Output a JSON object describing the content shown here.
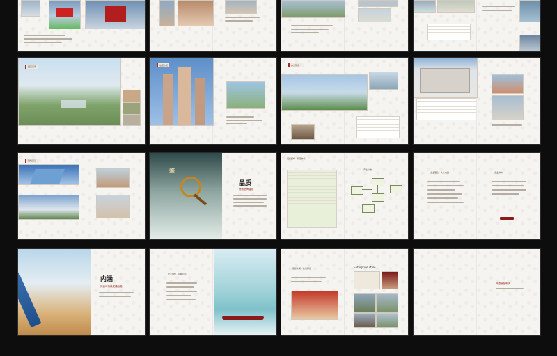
{
  "spreads": [
    {
      "id": "s1",
      "left_tags": [],
      "caption": ""
    },
    {
      "id": "s2"
    },
    {
      "id": "s3"
    },
    {
      "id": "s4"
    },
    {
      "id": "s5",
      "header": "园区风景"
    },
    {
      "id": "s6",
      "header": "住宅小区"
    },
    {
      "id": "s7",
      "header": "办公环境"
    },
    {
      "id": "s8",
      "header": "办公楼"
    },
    {
      "id": "s9",
      "header": "建筑风采"
    },
    {
      "id": "s10",
      "title": "品质",
      "subtitle": "缔造品牌建设",
      "emblem_title": "鉴"
    },
    {
      "id": "s11",
      "left_title": "组织结构 · 管理体系",
      "right_title": "产业分布"
    },
    {
      "id": "s12",
      "left_title": "企业理念 · 文化内涵",
      "right_title": "企业精神"
    },
    {
      "id": "s13",
      "title": "内涵",
      "subtitle": "缔造可持续发展战略"
    },
    {
      "id": "s14",
      "left_title": "企业理想 · 战略目标"
    },
    {
      "id": "s15",
      "left_title": "展望未来 · 共创辉煌",
      "right_title": "Enterprise style"
    },
    {
      "id": "s16",
      "note": "辉煌就在明天"
    }
  ],
  "colors": {
    "page_bg": "#f6f4f1",
    "accent": "#8b1a1a",
    "backdrop": "#0d0d0d"
  }
}
